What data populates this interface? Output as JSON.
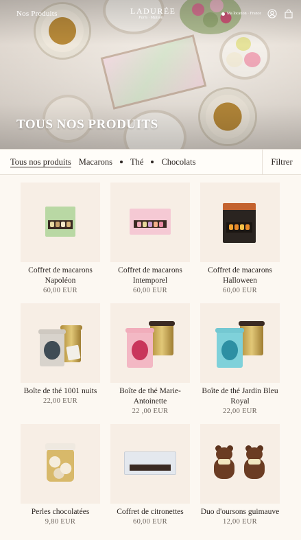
{
  "header": {
    "nav_label": "Nos Produits",
    "brand": "LADURÉE",
    "brand_sub": "Paris · Maison",
    "location_label": "Ma location · France"
  },
  "hero": {
    "title": "TOUS NOS PRODUITS"
  },
  "filters": {
    "categories": [
      {
        "label": "Tous nos produits",
        "active": true
      },
      {
        "label": "Macarons",
        "active": false
      },
      {
        "label": "Thé",
        "active": false
      },
      {
        "label": "Chocolats",
        "active": false
      }
    ],
    "filter_label": "Filtrer"
  },
  "products": [
    {
      "name": "Coffret de macarons Napoléon",
      "price": "60,00 EUR",
      "icon": "macaron-box-green"
    },
    {
      "name": "Coffret de macarons Intemporel",
      "price": "60,00 EUR",
      "icon": "macaron-box-pink"
    },
    {
      "name": "Coffret de macarons Halloween",
      "price": "60,00 EUR",
      "icon": "macaron-box-black"
    },
    {
      "name": "Boîte de thé 1001 nuits",
      "price": "22,00 EUR",
      "icon": "tea-tin-grey"
    },
    {
      "name": "Boîte de thé Marie-Antoinette",
      "price": "22 ,00 EUR",
      "icon": "tea-tin-pink"
    },
    {
      "name": "Boîte de thé Jardin Bleu Royal",
      "price": "22,00 EUR",
      "icon": "tea-tin-blue"
    },
    {
      "name": "Perles chocolatées",
      "price": "9,80 EUR",
      "icon": "chocolate-pearls-jar"
    },
    {
      "name": "Coffret de citronettes",
      "price": "60,00 EUR",
      "icon": "citronettes-box"
    },
    {
      "name": "Duo d'oursons guimauve",
      "price": "12,00 EUR",
      "icon": "marshmallow-bears"
    }
  ],
  "colors": {
    "background": "#fcf8f2",
    "card_bg": "#f7eee5",
    "text": "#2b2420",
    "price": "#6e655e"
  }
}
